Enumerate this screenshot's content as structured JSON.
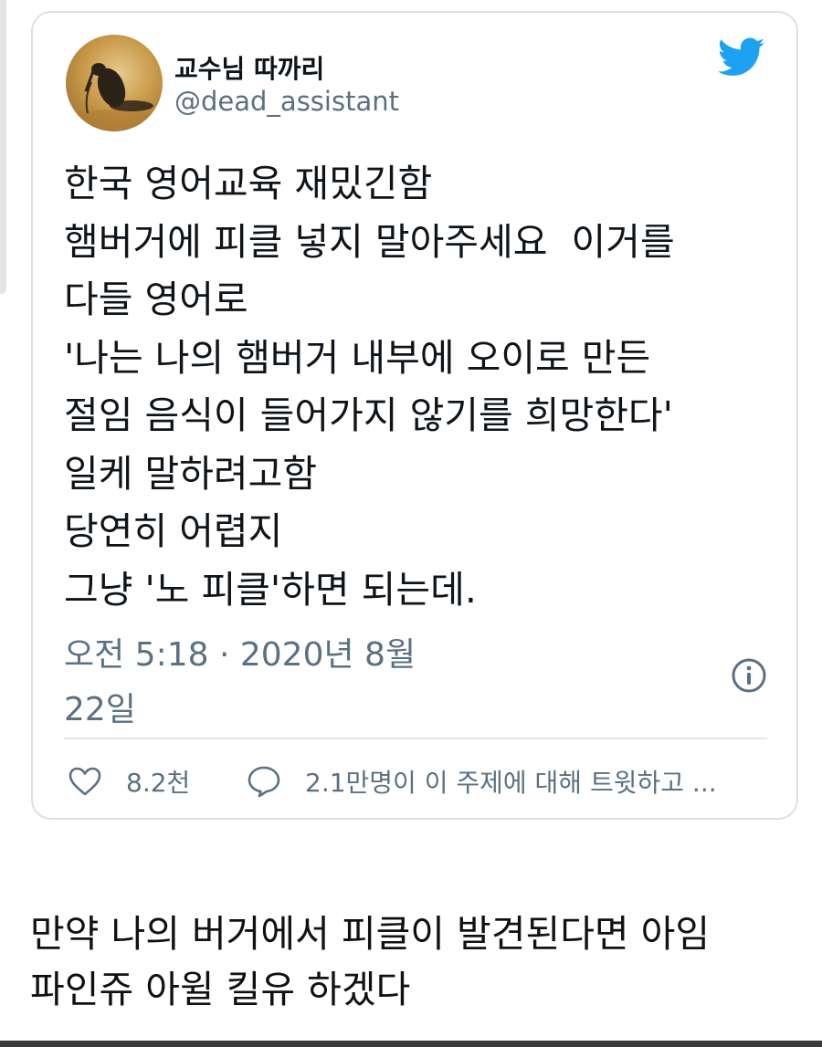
{
  "tweet": {
    "author": {
      "display_name": "교수님 따까리",
      "handle": "@dead_assistant"
    },
    "text": "한국 영어교육 재밌긴함\n햄버거에 피클 넣지 말아주세요  이거를\n다들 영어로\n'나는 나의 햄버거 내부에 오이로 만든\n절임 음식이 들어가지 않기를 희망한다'\n일케 말하려고함\n당연히 어렵지\n그냥 '노 피클'하면 되는데.",
    "timestamp": "오전 5:18 · 2020년 8월 22일",
    "likes": "8.2천",
    "topic_activity": "2.1만명이 이 주제에 대해 트윗하고 ...",
    "icons": {
      "logo": "twitter-bird-icon",
      "info": "info-icon",
      "like": "heart-icon",
      "reply": "speech-bubble-icon"
    },
    "colors": {
      "twitter_blue": "#1da1f2",
      "secondary_text": "#5b7083",
      "border": "#d9e1e8"
    }
  },
  "caption": "만약 나의 버거에서 피클이 발견된다면 아임\n파인쥬 아윌 킬유 하겠다"
}
